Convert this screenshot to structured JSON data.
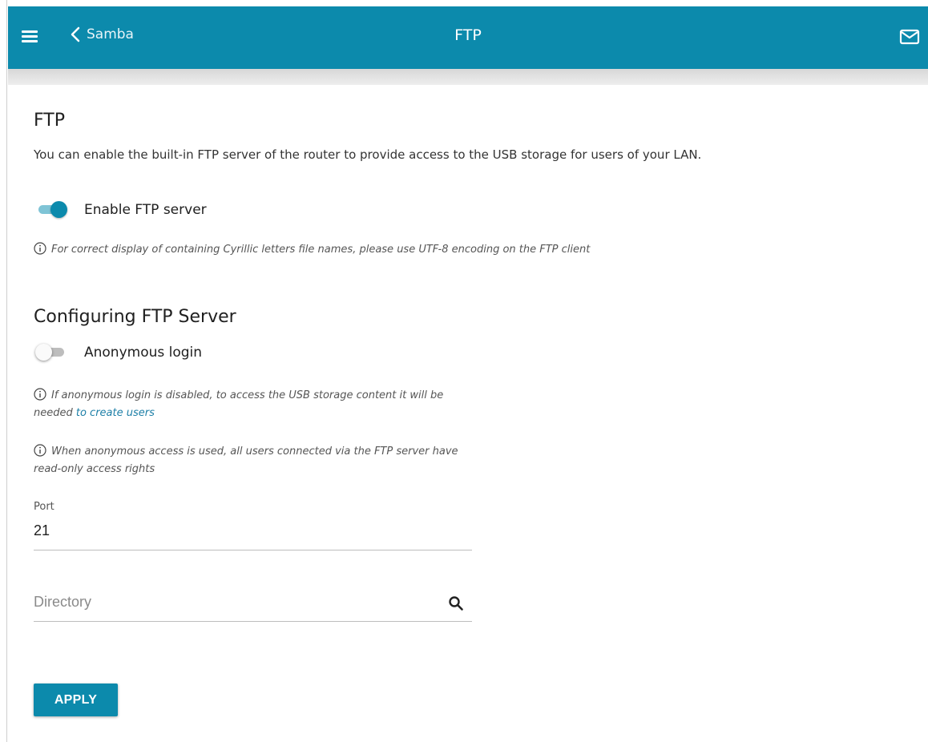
{
  "header": {
    "back_label": "Samba",
    "title": "FTP",
    "bar_color": "#0c8aac"
  },
  "section_ftp": {
    "heading": "FTP",
    "description": "You can enable the built-in FTP server of the router to provide access to the USB storage for users of your LAN.",
    "enable_toggle": {
      "label": "Enable FTP server",
      "checked": true
    },
    "note": "For correct display of containing Cyrillic letters file names, please use UTF-8 encoding on the FTP client"
  },
  "section_config": {
    "heading": "Configuring FTP Server",
    "anonymous_toggle": {
      "label": "Anonymous login",
      "checked": false
    },
    "note1_text": "If anonymous login is disabled, to access the USB storage content it will be needed ",
    "note1_link": "to create users",
    "note2_text": "When anonymous access is used, all users connected via the FTP server have read-only access rights"
  },
  "form": {
    "port_label": "Port",
    "port_value": "21",
    "directory_placeholder": "Directory",
    "directory_value": ""
  },
  "actions": {
    "apply_label": "APPLY"
  },
  "icons": {
    "menu": "hamburger-icon",
    "back": "chevron-left-icon",
    "mail": "envelope-icon",
    "info": "info-icon",
    "search": "search-icon"
  }
}
